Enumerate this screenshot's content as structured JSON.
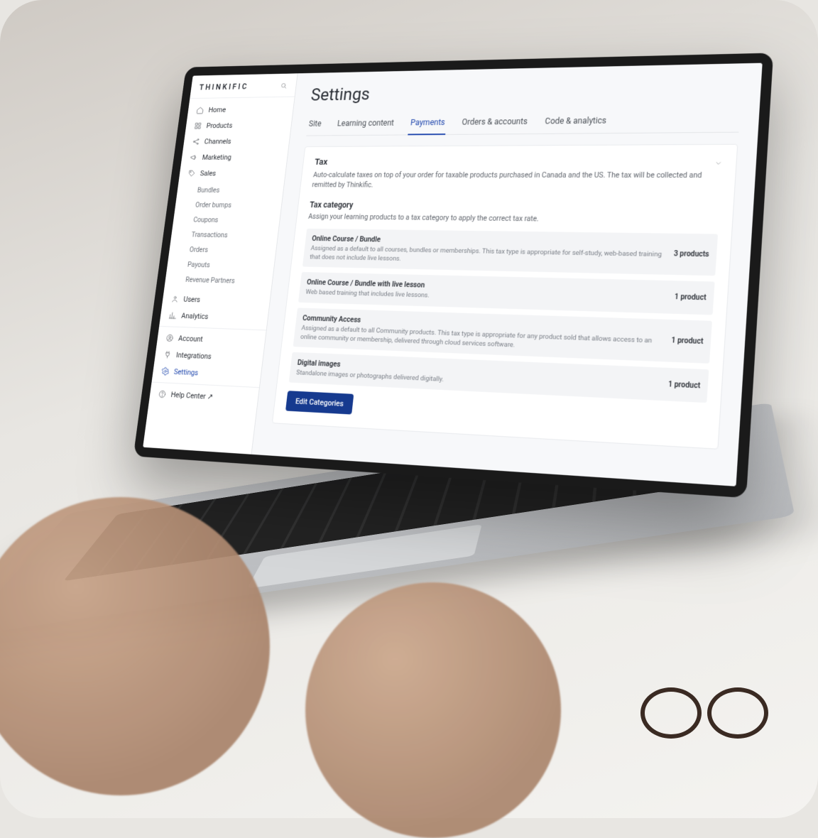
{
  "brand": "THINKIFIC",
  "sidebar": {
    "items": [
      {
        "label": "Home"
      },
      {
        "label": "Products"
      },
      {
        "label": "Channels"
      },
      {
        "label": "Marketing"
      },
      {
        "label": "Sales"
      },
      {
        "label": "Users"
      },
      {
        "label": "Analytics"
      },
      {
        "label": "Account"
      },
      {
        "label": "Integrations"
      },
      {
        "label": "Settings"
      },
      {
        "label": "Help Center ↗"
      }
    ],
    "sales_sub": [
      {
        "label": "Bundles"
      },
      {
        "label": "Order bumps"
      },
      {
        "label": "Coupons"
      },
      {
        "label": "Transactions"
      },
      {
        "label": "Orders"
      },
      {
        "label": "Payouts"
      },
      {
        "label": "Revenue Partners"
      }
    ]
  },
  "page": {
    "title": "Settings"
  },
  "tabs": [
    {
      "label": "Site"
    },
    {
      "label": "Learning content"
    },
    {
      "label": "Payments",
      "active": true
    },
    {
      "label": "Orders & accounts"
    },
    {
      "label": "Code & analytics"
    }
  ],
  "tax": {
    "heading": "Tax",
    "desc": "Auto-calculate taxes on top of your order for taxable products purchased in Canada and the US. The tax will be collected and remitted by Thinkific.",
    "cat_heading": "Tax category",
    "cat_desc": "Assign your learning products to a tax category to apply the correct tax rate.",
    "categories": [
      {
        "title": "Online Course / Bundle",
        "desc": "Assigned as a default to all courses, bundles or memberships. This tax type is appropriate for self-study, web-based training that does not include live lessons.",
        "count": "3 products"
      },
      {
        "title": "Online Course / Bundle with live lesson",
        "desc": "Web based training that includes live lessons.",
        "count": "1 product"
      },
      {
        "title": "Community Access",
        "desc": "Assigned as a default to all Community products. This tax type is appropriate for any product sold that allows access to an online community or membership, delivered through cloud services software.",
        "count": "1 product"
      },
      {
        "title": "Digital images",
        "desc": "Standalone images or photographs delivered digitally.",
        "count": "1 product"
      }
    ],
    "button": "Edit Categories"
  }
}
